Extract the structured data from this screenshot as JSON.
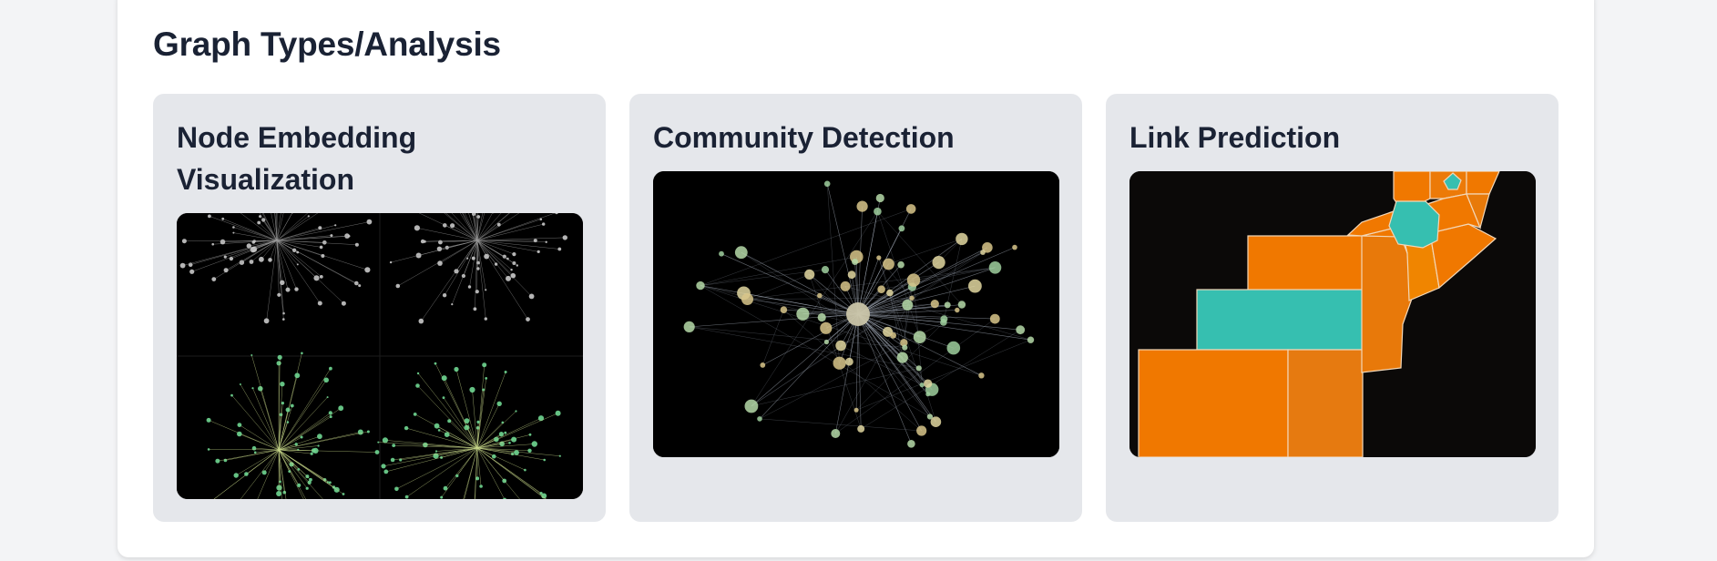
{
  "section": {
    "title": "Graph Types/Analysis"
  },
  "cards": [
    {
      "title": "Node Embedding Visualization",
      "image_icon": "node-embedding-image"
    },
    {
      "title": "Community Detection",
      "image_icon": "community-network-image"
    },
    {
      "title": "Link Prediction",
      "image_icon": "link-prediction-map-image"
    }
  ],
  "colors": {
    "page_bg": "#f3f4f6",
    "panel_bg": "#ffffff",
    "card_bg": "#e5e7eb",
    "heading": "#1a2234",
    "accent_orange": "#f07800",
    "accent_teal": "#36bfb0",
    "node_green": "#6fd691",
    "node_gold": "#d8c58a"
  }
}
